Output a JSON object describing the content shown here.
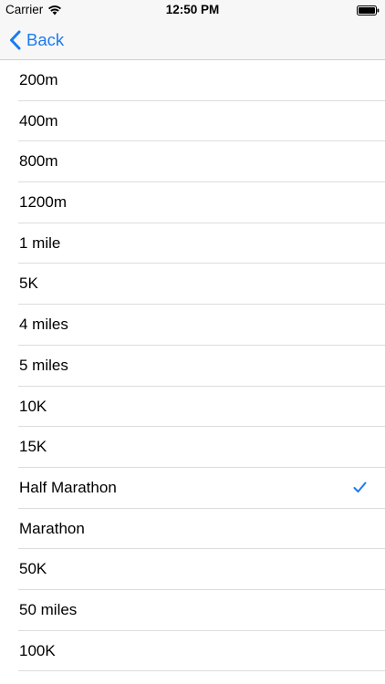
{
  "status_bar": {
    "carrier": "Carrier",
    "time": "12:50 PM",
    "wifi_icon": "wifi-icon",
    "battery_icon": "battery-icon"
  },
  "nav_bar": {
    "back_label": "Back",
    "back_icon": "chevron-left-icon",
    "accent_color": "#1a7bef"
  },
  "distances": {
    "selected": "Half Marathon",
    "check_icon": "checkmark-icon",
    "items": [
      {
        "label": "200m",
        "selected": false
      },
      {
        "label": "400m",
        "selected": false
      },
      {
        "label": "800m",
        "selected": false
      },
      {
        "label": "1200m",
        "selected": false
      },
      {
        "label": "1 mile",
        "selected": false
      },
      {
        "label": "5K",
        "selected": false
      },
      {
        "label": "4 miles",
        "selected": false
      },
      {
        "label": "5 miles",
        "selected": false
      },
      {
        "label": "10K",
        "selected": false
      },
      {
        "label": "15K",
        "selected": false
      },
      {
        "label": "Half Marathon",
        "selected": true
      },
      {
        "label": "Marathon",
        "selected": false
      },
      {
        "label": "50K",
        "selected": false
      },
      {
        "label": "50 miles",
        "selected": false
      },
      {
        "label": "100K",
        "selected": false
      }
    ]
  }
}
